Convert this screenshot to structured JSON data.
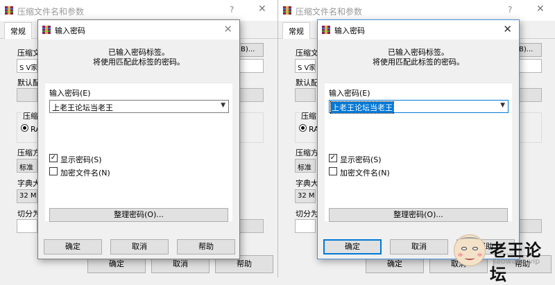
{
  "parent": {
    "title": "压缩文件名和参数",
    "help_icon": "?",
    "close_icon": "✕",
    "tab_general": "常规",
    "label_archive_name": "压缩文",
    "archive_name_value": "S V家",
    "browse_button_partial": "B)...",
    "label_default": "默认配",
    "group_label": "压缩",
    "radio_partial": "RA",
    "label_method": "压缩方",
    "method_value": "标准",
    "label_dict": "字典大",
    "dict_value": "32 MB",
    "label_split": "切分为",
    "ok": "确定",
    "cancel": "取消",
    "help": "帮助"
  },
  "modal": {
    "title": "输入密码",
    "close_icon": "✕",
    "info_line1": "已输入密码标签。",
    "info_line2": "将使用匹配此标签的密码。",
    "password_label": "输入密码(E)",
    "password_value": "上老王论坛当老王",
    "show_password_label": "显示密码(S)",
    "show_password_checked": "✓",
    "encrypt_filenames_label": "加密文件名(N)",
    "organize_button": "整理密码(O)...",
    "ok": "确定",
    "cancel": "取消",
    "help": "帮助"
  },
  "watermark": {
    "name": "老王论坛",
    "url": "laowang.vip"
  }
}
